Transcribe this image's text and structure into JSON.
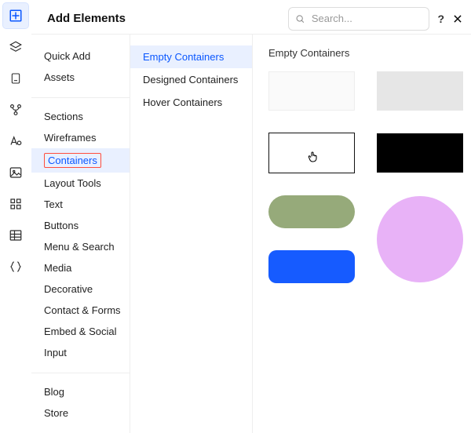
{
  "header": {
    "title": "Add Elements",
    "search_placeholder": "Search...",
    "help_symbol": "?"
  },
  "rail_icons": [
    "plus-grid-icon",
    "layers-icon",
    "page-icon",
    "branch-icon",
    "text-style-icon",
    "image-icon",
    "apps-icon",
    "table-icon",
    "braces-icon"
  ],
  "col1": {
    "groups": [
      {
        "items": [
          {
            "key": "quick",
            "label": "Quick Add"
          },
          {
            "key": "assets",
            "label": "Assets"
          }
        ]
      },
      {
        "items": [
          {
            "key": "sections",
            "label": "Sections"
          },
          {
            "key": "wireframes",
            "label": "Wireframes"
          },
          {
            "key": "containers",
            "label": "Containers",
            "active": true
          },
          {
            "key": "layout",
            "label": "Layout Tools"
          },
          {
            "key": "text",
            "label": "Text"
          },
          {
            "key": "buttons",
            "label": "Buttons"
          },
          {
            "key": "menu",
            "label": "Menu & Search"
          },
          {
            "key": "media",
            "label": "Media"
          },
          {
            "key": "decorative",
            "label": "Decorative"
          },
          {
            "key": "contact",
            "label": "Contact & Forms"
          },
          {
            "key": "embed",
            "label": "Embed & Social"
          },
          {
            "key": "input",
            "label": "Input"
          }
        ]
      },
      {
        "items": [
          {
            "key": "blog",
            "label": "Blog"
          },
          {
            "key": "store",
            "label": "Store"
          }
        ]
      }
    ]
  },
  "col2": {
    "items": [
      {
        "key": "empty",
        "label": "Empty Containers",
        "active": true
      },
      {
        "key": "designed",
        "label": "Designed Containers"
      },
      {
        "key": "hover",
        "label": "Hover Containers"
      }
    ]
  },
  "col3": {
    "section_title": "Empty Containers",
    "shapes": [
      "light-box",
      "grey-box",
      "outline-box",
      "black-box",
      "green-pill",
      "purple-circle",
      "blue-round"
    ],
    "colors": {
      "pill": "#96aa7a",
      "blue": "#165bff",
      "circle": "#e8b2f7"
    }
  }
}
